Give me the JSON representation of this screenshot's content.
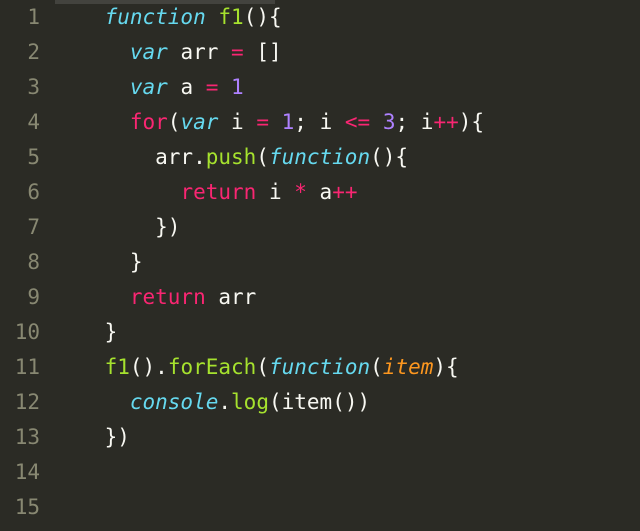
{
  "editor": {
    "line_numbers": [
      "1",
      "2",
      "3",
      "4",
      "5",
      "6",
      "7",
      "8",
      "9",
      "10",
      "11",
      "12",
      "13",
      "14",
      "15"
    ],
    "lines": [
      [
        {
          "cls": "tok-plain",
          "t": "    "
        },
        {
          "cls": "tok-kw",
          "t": "function"
        },
        {
          "cls": "tok-plain",
          "t": " "
        },
        {
          "cls": "tok-fnname",
          "t": "f1"
        },
        {
          "cls": "tok-punc",
          "t": "(){"
        }
      ],
      [
        {
          "cls": "tok-plain",
          "t": "      "
        },
        {
          "cls": "tok-kw",
          "t": "var"
        },
        {
          "cls": "tok-plain",
          "t": " arr "
        },
        {
          "cls": "tok-kw2",
          "t": "="
        },
        {
          "cls": "tok-plain",
          "t": " []"
        }
      ],
      [
        {
          "cls": "tok-plain",
          "t": "      "
        },
        {
          "cls": "tok-kw",
          "t": "var"
        },
        {
          "cls": "tok-plain",
          "t": " a "
        },
        {
          "cls": "tok-kw2",
          "t": "="
        },
        {
          "cls": "tok-plain",
          "t": " "
        },
        {
          "cls": "tok-num",
          "t": "1"
        }
      ],
      [
        {
          "cls": "tok-plain",
          "t": "      "
        },
        {
          "cls": "tok-kw2",
          "t": "for"
        },
        {
          "cls": "tok-punc",
          "t": "("
        },
        {
          "cls": "tok-kw",
          "t": "var"
        },
        {
          "cls": "tok-plain",
          "t": " i "
        },
        {
          "cls": "tok-kw2",
          "t": "="
        },
        {
          "cls": "tok-plain",
          "t": " "
        },
        {
          "cls": "tok-num",
          "t": "1"
        },
        {
          "cls": "tok-punc",
          "t": "; "
        },
        {
          "cls": "tok-plain",
          "t": "i "
        },
        {
          "cls": "tok-kw2",
          "t": "<="
        },
        {
          "cls": "tok-plain",
          "t": " "
        },
        {
          "cls": "tok-num",
          "t": "3"
        },
        {
          "cls": "tok-punc",
          "t": "; "
        },
        {
          "cls": "tok-plain",
          "t": "i"
        },
        {
          "cls": "tok-kw2",
          "t": "++"
        },
        {
          "cls": "tok-punc",
          "t": "){"
        }
      ],
      [
        {
          "cls": "tok-plain",
          "t": "        arr."
        },
        {
          "cls": "tok-fnname",
          "t": "push"
        },
        {
          "cls": "tok-punc",
          "t": "("
        },
        {
          "cls": "tok-kw",
          "t": "function"
        },
        {
          "cls": "tok-punc",
          "t": "(){"
        }
      ],
      [
        {
          "cls": "tok-plain",
          "t": "          "
        },
        {
          "cls": "tok-kw2",
          "t": "return"
        },
        {
          "cls": "tok-plain",
          "t": " i "
        },
        {
          "cls": "tok-kw2",
          "t": "*"
        },
        {
          "cls": "tok-plain",
          "t": " a"
        },
        {
          "cls": "tok-kw2",
          "t": "++"
        }
      ],
      [
        {
          "cls": "tok-plain",
          "t": "        })"
        }
      ],
      [
        {
          "cls": "tok-plain",
          "t": "      }"
        }
      ],
      [
        {
          "cls": "tok-plain",
          "t": "      "
        },
        {
          "cls": "tok-kw2",
          "t": "return"
        },
        {
          "cls": "tok-plain",
          "t": " arr"
        }
      ],
      [
        {
          "cls": "tok-plain",
          "t": "    }"
        }
      ],
      [
        {
          "cls": "tok-plain",
          "t": "    "
        },
        {
          "cls": "tok-fnname",
          "t": "f1"
        },
        {
          "cls": "tok-punc",
          "t": "()."
        },
        {
          "cls": "tok-fnname",
          "t": "forEach"
        },
        {
          "cls": "tok-punc",
          "t": "("
        },
        {
          "cls": "tok-kw",
          "t": "function"
        },
        {
          "cls": "tok-punc",
          "t": "("
        },
        {
          "cls": "tok-param",
          "t": "item"
        },
        {
          "cls": "tok-punc",
          "t": "){"
        }
      ],
      [
        {
          "cls": "tok-plain",
          "t": "      "
        },
        {
          "cls": "tok-obj",
          "t": "console"
        },
        {
          "cls": "tok-punc",
          "t": "."
        },
        {
          "cls": "tok-fnname",
          "t": "log"
        },
        {
          "cls": "tok-punc",
          "t": "("
        },
        {
          "cls": "tok-plain",
          "t": "item"
        },
        {
          "cls": "tok-punc",
          "t": "())"
        }
      ],
      [
        {
          "cls": "tok-plain",
          "t": "    })"
        }
      ],
      [],
      []
    ]
  }
}
